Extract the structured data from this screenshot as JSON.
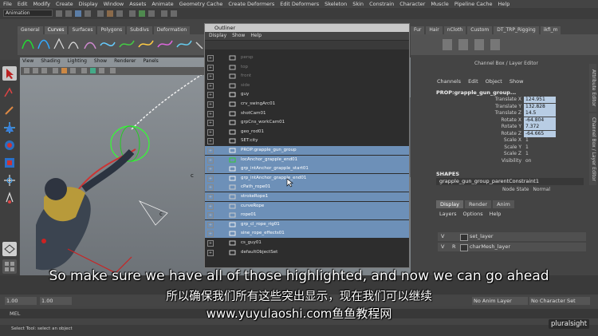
{
  "menubar": [
    "File",
    "Edit",
    "Modify",
    "Create",
    "Display",
    "Window",
    "Assets",
    "Animate",
    "Geometry Cache",
    "Create Deformers",
    "Edit Deformers",
    "Skeleton",
    "Skin",
    "Constrain",
    "Character",
    "Muscle",
    "Pipeline Cache",
    "Help"
  ],
  "mode_selector": "Animation",
  "shelf_tabs_left": [
    "General",
    "Curves",
    "Surfaces",
    "Polygons",
    "Subdivs",
    "Deformation"
  ],
  "shelf_tabs_left_active": 1,
  "shelf_tabs_right": [
    "Fur",
    "Hair",
    "nCloth",
    "Custom",
    "DT_TRP_Rigging",
    "ikfi_m"
  ],
  "viewport_menu": [
    "View",
    "Shading",
    "Lighting",
    "Show",
    "Renderer",
    "Panels"
  ],
  "viewport_labels": [
    "c",
    "c"
  ],
  "outliner": {
    "title": "Outliner",
    "menu": [
      "Display",
      "Show",
      "Help"
    ],
    "items": [
      {
        "label": "persp",
        "state": "dim"
      },
      {
        "label": "top",
        "state": "dim"
      },
      {
        "label": "front",
        "state": "dim"
      },
      {
        "label": "side",
        "state": "dim"
      },
      {
        "label": "guy",
        "state": "normal"
      },
      {
        "label": "crv_swingArc01",
        "state": "normal"
      },
      {
        "label": "shotCam01",
        "state": "normal"
      },
      {
        "label": "grpCns_workCam01",
        "state": "normal"
      },
      {
        "label": "geo_rod01",
        "state": "normal"
      },
      {
        "label": "SET:city",
        "state": "normal"
      },
      {
        "label": "PROP:grapple_gun_group",
        "state": "sel"
      },
      {
        "label": "locAnchor_grapple_end01",
        "state": "sel"
      },
      {
        "label": "grp_intAnchor_grapple_start01",
        "state": "sel"
      },
      {
        "label": "grp_intAnchor_grapple_end01",
        "state": "sel"
      },
      {
        "label": "cPath_rope01",
        "state": "sel"
      },
      {
        "label": "strokeRope1",
        "state": "sel"
      },
      {
        "label": "curveRope",
        "state": "sel"
      },
      {
        "label": "rope01",
        "state": "sel"
      },
      {
        "label": "grp_cl_rope_rig01",
        "state": "sel"
      },
      {
        "label": "sine_rope_effects01",
        "state": "sel"
      },
      {
        "label": "cs_guy01",
        "state": "normal"
      },
      {
        "label": "defaultObjectSet",
        "state": "normal"
      }
    ]
  },
  "channel_box": {
    "title": "Channel Box / Layer Editor",
    "menu": [
      "Channels",
      "Edit",
      "Object",
      "Show"
    ],
    "node": "PROP:grapple_gun_group...",
    "attrs": [
      {
        "name": "Translate X",
        "value": "124.951",
        "hl": true
      },
      {
        "name": "Translate Y",
        "value": "132.828",
        "hl": true
      },
      {
        "name": "Translate Z",
        "value": "14.5",
        "hl": true
      },
      {
        "name": "Rotate X",
        "value": "-64.804",
        "hl": true
      },
      {
        "name": "Rotate Y",
        "value": "7.372",
        "hl": true
      },
      {
        "name": "Rotate Z",
        "value": "-64.665",
        "hl": true
      },
      {
        "name": "Scale X",
        "value": "1",
        "hl": false
      },
      {
        "name": "Scale Y",
        "value": "1",
        "hl": false
      },
      {
        "name": "Scale Z",
        "value": "1",
        "hl": false
      },
      {
        "name": "Visibility",
        "value": "on",
        "hl": false
      }
    ],
    "shapes_label": "SHAPES",
    "shape_node": "grapple_gun_group_parentConstraint1",
    "node_state_label": "Node State",
    "node_state_value": "Normal"
  },
  "side_tabs": [
    "Attribute Editor",
    "Channel Box / Layer Editor"
  ],
  "layer_editor": {
    "tabs": [
      "Display",
      "Render",
      "Anim"
    ],
    "active": 0,
    "menu": [
      "Layers",
      "Options",
      "Help"
    ],
    "layers": [
      {
        "v": "V",
        "r": "",
        "name": "set_layer"
      },
      {
        "v": "V",
        "r": "R",
        "name": "charMesh_layer"
      }
    ]
  },
  "range": {
    "start": "1.00",
    "start2": "1.00",
    "anim_layer": "No Anim Layer",
    "char_set": "No Character Set"
  },
  "cmd_label": "MEL",
  "help_line": "Select Tool: select an object",
  "subtitle_en": "So make sure we have all of those highlighted, and now we can go ahead",
  "subtitle_cn": "所以确保我们所有这些突出显示，现在我们可以继续",
  "subtitle_url": "www.yuyulaoshi.com鱼鱼教程网",
  "watermark": "pluralsight",
  "colors": {
    "selection": "#6d90b8",
    "channel_hl": "#b8cde4"
  }
}
